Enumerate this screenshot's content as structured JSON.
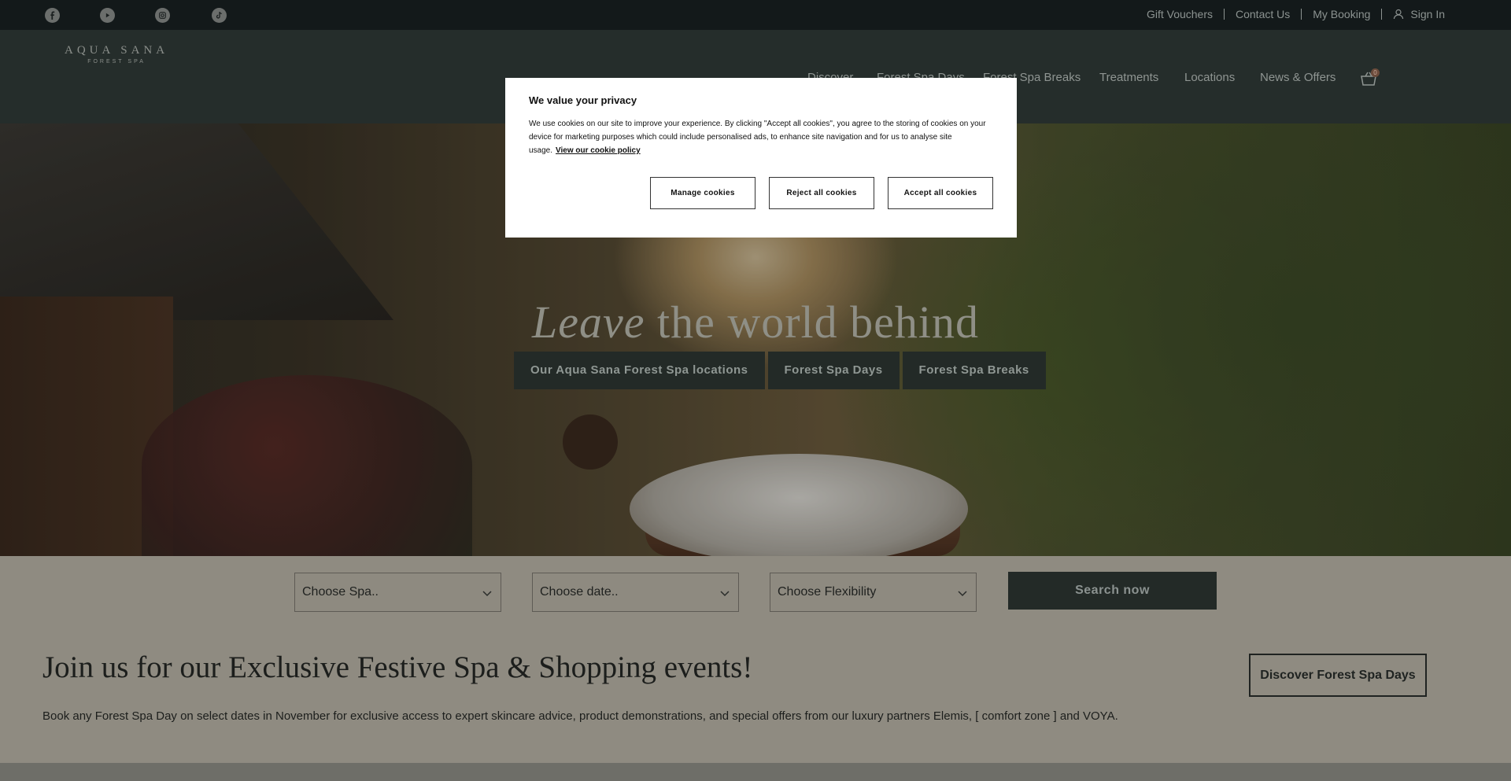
{
  "top_bar": {
    "social": [
      "facebook-icon",
      "youtube-icon",
      "instagram-icon",
      "tiktok-icon"
    ],
    "links": [
      "Gift Vouchers",
      "Contact Us",
      "My Booking",
      "Sign In"
    ]
  },
  "header": {
    "logo_line1": "AQUA SANA",
    "logo_line2": "FOREST SPA",
    "nav": [
      "Discover",
      "Forest Spa Days",
      "Forest Spa Breaks",
      "Treatments",
      "Locations",
      "News & Offers"
    ],
    "basket_count": "0"
  },
  "hero": {
    "title_italic": "Leave",
    "title_rest": " the world behind",
    "buttons": [
      "Our Aqua Sana Forest Spa locations",
      "Forest Spa Days",
      "Forest Spa Breaks"
    ]
  },
  "search": {
    "spa_placeholder": "Choose Spa..",
    "date_placeholder": "Choose date..",
    "flex_placeholder": "Choose Flexibility",
    "button": "Search now"
  },
  "promo": {
    "title": "Join us for our Exclusive Festive Spa & Shopping events!",
    "text": "Book any Forest Spa Day on select dates in November for exclusive access to expert skincare advice, product demonstrations, and special offers from our luxury partners Elemis, [ comfort zone ] and VOYA.",
    "button": "Discover Forest Spa Days"
  },
  "cookie_modal": {
    "title": "We value your privacy",
    "body": "We use cookies on our site to improve your experience. By clicking \"Accept all cookies\", you agree to the storing of cookies on your device for marketing purposes which could include personalised ads, to enhance site navigation and for us to analyse site usage.",
    "policy_link": "View our cookie policy",
    "manage": "Manage cookies",
    "reject": "Reject all cookies",
    "accept": "Accept all cookies"
  }
}
